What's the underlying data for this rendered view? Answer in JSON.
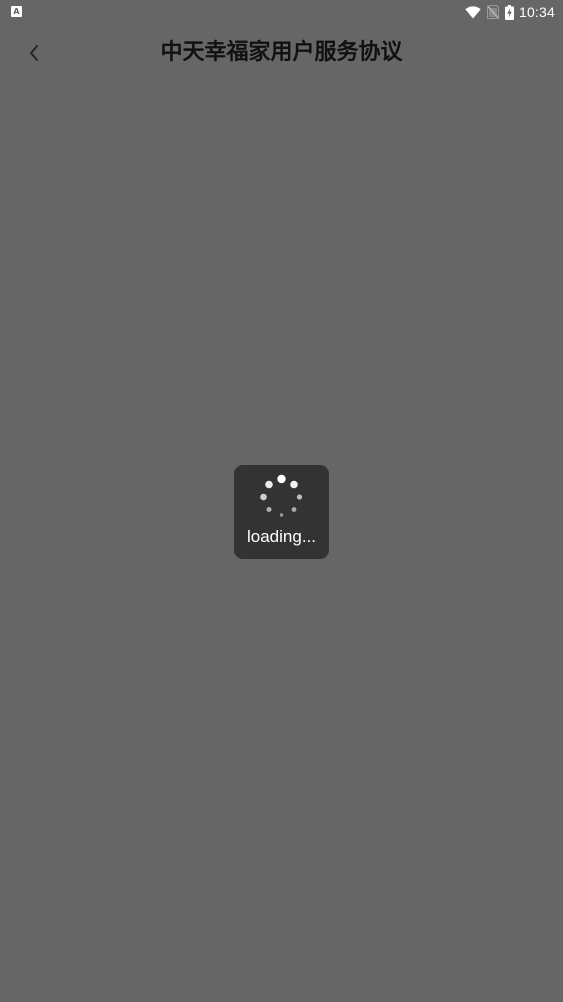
{
  "status_bar": {
    "time": "10:34",
    "left_icon_letter": "A",
    "icons": [
      "android-notification-icon",
      "wifi-icon",
      "no-sim-icon",
      "battery-charging-icon"
    ]
  },
  "header": {
    "title": "中天幸福家用户服务协议",
    "back_icon": "chevron-left-icon"
  },
  "loading": {
    "text": "loading...",
    "spinner_icon": "spinner-icon"
  },
  "colors": {
    "background": "#666666",
    "toast_background": "#333333",
    "title_text": "#111111",
    "status_text": "#ffffff"
  }
}
